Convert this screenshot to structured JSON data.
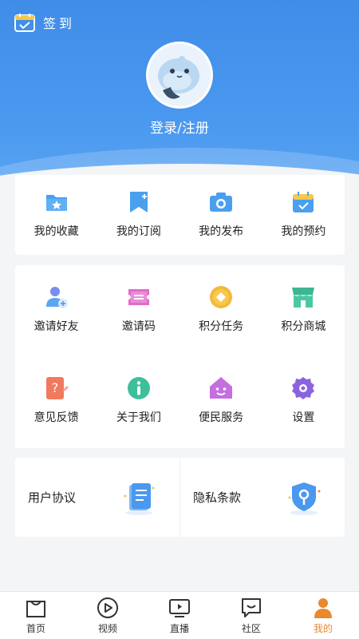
{
  "header": {
    "checkin_label": "签到",
    "login_label": "登录/注册"
  },
  "quick_menu": [
    {
      "label": "我的收藏",
      "icon": "folder-star-icon"
    },
    {
      "label": "我的订阅",
      "icon": "bookmark-plus-icon"
    },
    {
      "label": "我的发布",
      "icon": "camera-icon"
    },
    {
      "label": "我的预约",
      "icon": "calendar-check-icon"
    }
  ],
  "services": [
    {
      "label": "邀请好友",
      "icon": "add-user-icon"
    },
    {
      "label": "邀请码",
      "icon": "ticket-icon"
    },
    {
      "label": "积分任务",
      "icon": "coin-icon"
    },
    {
      "label": "积分商城",
      "icon": "store-icon"
    },
    {
      "label": "意见反馈",
      "icon": "feedback-icon"
    },
    {
      "label": "关于我们",
      "icon": "info-icon"
    },
    {
      "label": "便民服务",
      "icon": "home-smile-icon"
    },
    {
      "label": "设置",
      "icon": "gear-icon"
    }
  ],
  "agreements": {
    "user_agreement": "用户协议",
    "privacy_policy": "隐私条款"
  },
  "nav": [
    {
      "label": "首页",
      "icon": "home-icon"
    },
    {
      "label": "视频",
      "icon": "play-icon"
    },
    {
      "label": "直播",
      "icon": "tv-icon"
    },
    {
      "label": "社区",
      "icon": "chat-icon"
    },
    {
      "label": "我的",
      "icon": "person-icon",
      "active": true
    }
  ],
  "colors": {
    "header_blue": "#4a98ef",
    "accent_orange": "#e88a2f"
  }
}
